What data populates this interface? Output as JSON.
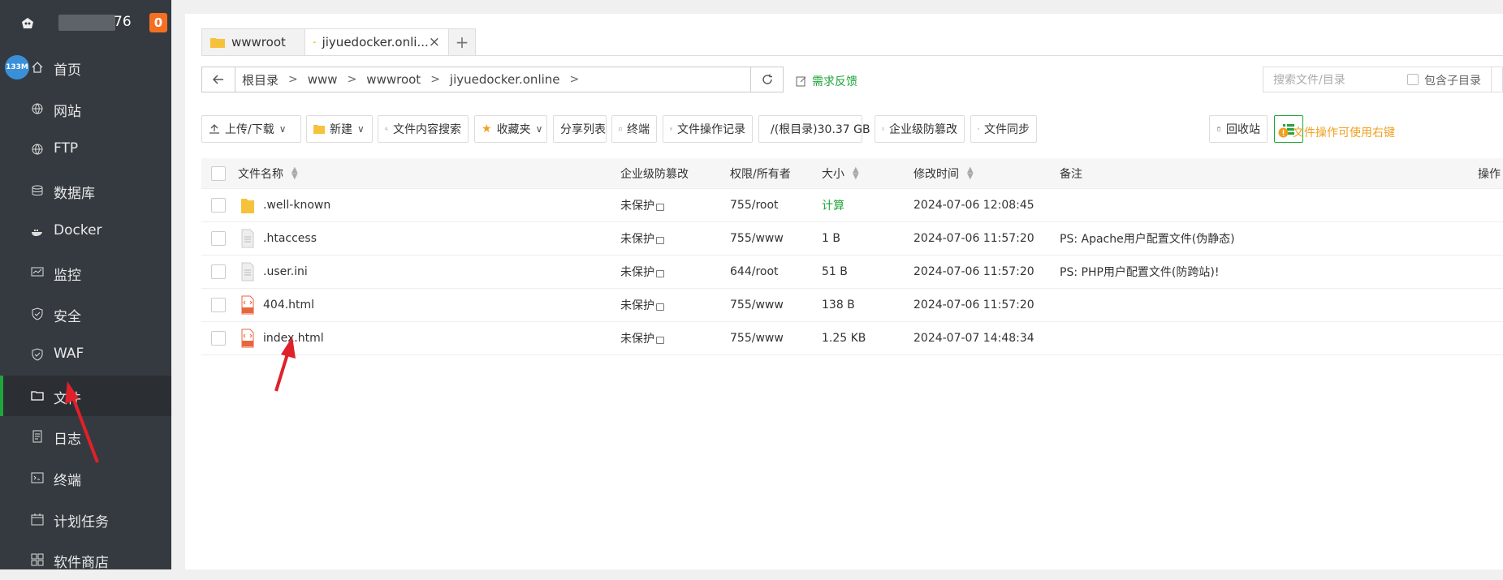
{
  "sidebar": {
    "ip_suffix": "76",
    "notification_count": "0",
    "memory_badge": "133M",
    "items": [
      {
        "label": "首页",
        "icon": "home-icon"
      },
      {
        "label": "网站",
        "icon": "globe-icon"
      },
      {
        "label": "FTP",
        "icon": "globe-icon"
      },
      {
        "label": "数据库",
        "icon": "database-icon"
      },
      {
        "label": "Docker",
        "icon": "docker-icon"
      },
      {
        "label": "监控",
        "icon": "monitor-icon"
      },
      {
        "label": "安全",
        "icon": "shield-icon"
      },
      {
        "label": "WAF",
        "icon": "shield-icon"
      },
      {
        "label": "文件",
        "icon": "folder-icon",
        "active": true
      },
      {
        "label": "日志",
        "icon": "log-icon"
      },
      {
        "label": "终端",
        "icon": "terminal-icon"
      },
      {
        "label": "计划任务",
        "icon": "calendar-icon"
      },
      {
        "label": "软件商店",
        "icon": "grid-icon"
      }
    ]
  },
  "tabs": [
    {
      "label": "wwwroot"
    },
    {
      "label": "jiyuedocker.onli...",
      "active": true
    }
  ],
  "tab_add": "+",
  "path": {
    "crumbs": [
      "根目录",
      "www",
      "wwwroot",
      "jiyuedocker.online"
    ],
    "feedback": "需求反馈"
  },
  "search": {
    "placeholder": "搜索文件/目录",
    "include_sub": "包含子目录"
  },
  "toolbar": {
    "upload": "上传/下载",
    "new": "新建",
    "content_search": "文件内容搜索",
    "favorites": "收藏夹",
    "share_list": "分享列表",
    "terminal": "终端",
    "op_log": "文件操作记录",
    "disk": "/(根目录)30.37 GB",
    "tamper": "企业级防篡改",
    "sync": "文件同步",
    "hint": "文件操作可使用右键",
    "recycle": "回收站"
  },
  "table": {
    "headers": {
      "name": "文件名称",
      "tamper": "企业级防篡改",
      "perm": "权限/所有者",
      "size": "大小",
      "mtime": "修改时间",
      "note": "备注",
      "ops": "操作"
    },
    "rows": [
      {
        "name": ".well-known",
        "type": "folder",
        "tamper": "未保护",
        "perm": "755/root",
        "size": "计算",
        "mtime": "2024-07-06 12:08:45",
        "note": ""
      },
      {
        "name": ".htaccess",
        "type": "file",
        "tamper": "未保护",
        "perm": "755/www",
        "size": "1 B",
        "mtime": "2024-07-06 11:57:20",
        "note": "PS: Apache用户配置文件(伪静态)"
      },
      {
        "name": ".user.ini",
        "type": "file",
        "tamper": "未保护",
        "perm": "644/root",
        "size": "51 B",
        "mtime": "2024-07-06 11:57:20",
        "note": "PS: PHP用户配置文件(防跨站)!"
      },
      {
        "name": "404.html",
        "type": "html",
        "tamper": "未保护",
        "perm": "755/www",
        "size": "138 B",
        "mtime": "2024-07-06 11:57:20",
        "note": ""
      },
      {
        "name": "index.html",
        "type": "html",
        "tamper": "未保护",
        "perm": "755/www",
        "size": "1.25 KB",
        "mtime": "2024-07-07 14:48:34",
        "note": ""
      }
    ]
  },
  "colors": {
    "sidebar_bg": "#353a40",
    "accent_green": "#20a53a",
    "annotation_red": "#e0202a",
    "hint_orange": "#f0a020"
  }
}
